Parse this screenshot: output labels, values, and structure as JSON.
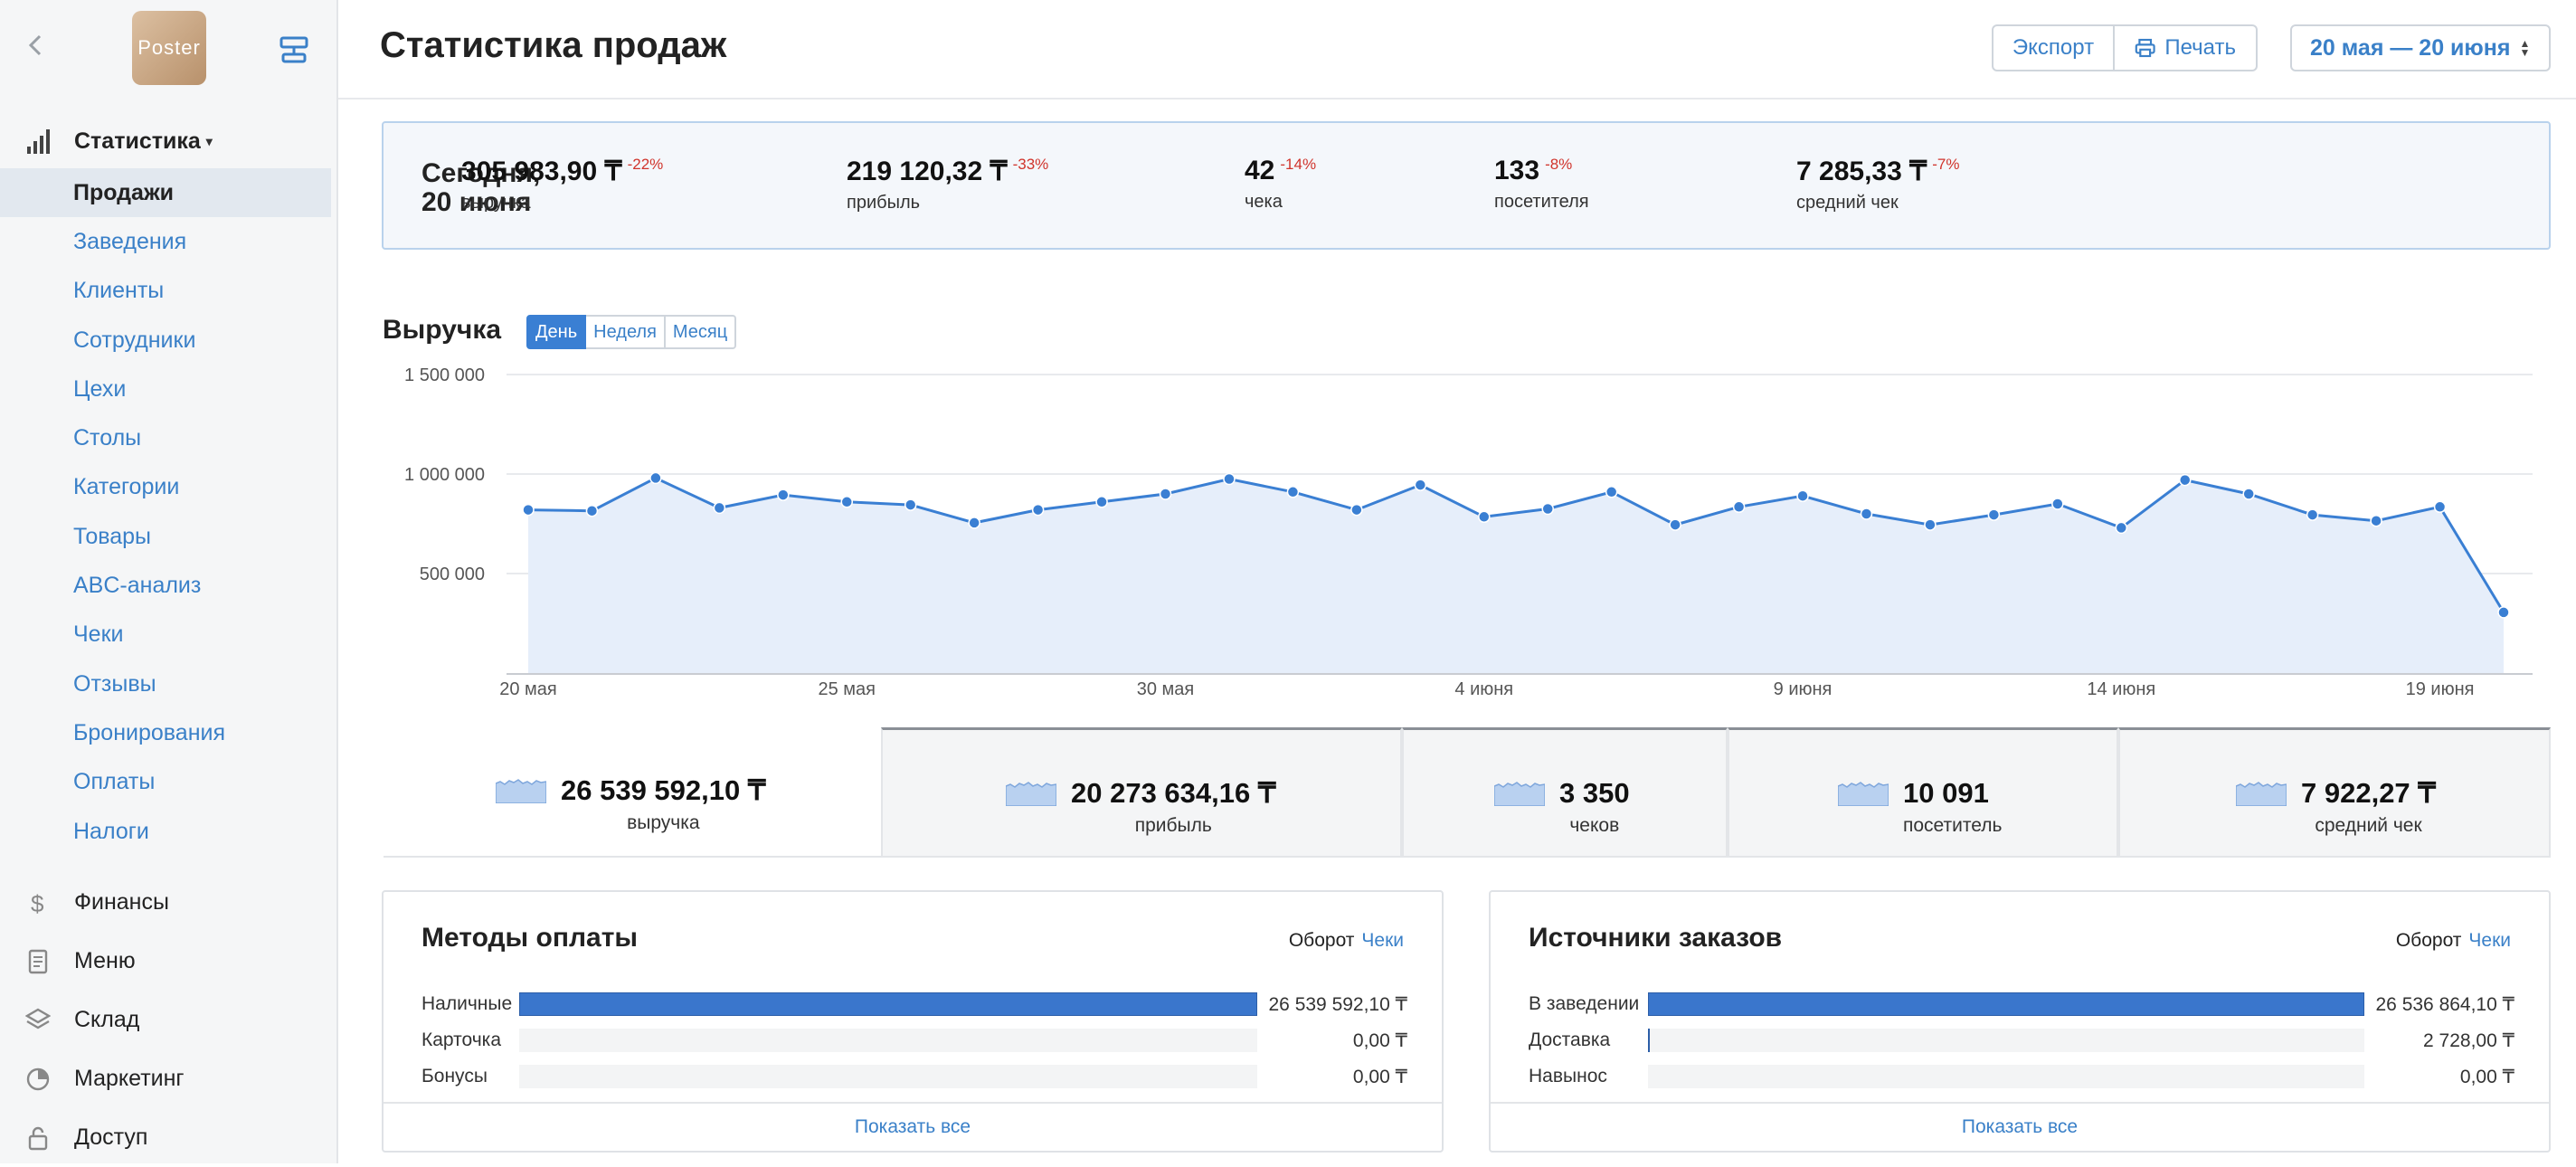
{
  "app": {
    "logo_text": "Poster"
  },
  "sidebar": {
    "section": {
      "label": "Статистика"
    },
    "items": [
      {
        "label": "Продажи",
        "active": true
      },
      {
        "label": "Заведения"
      },
      {
        "label": "Клиенты"
      },
      {
        "label": "Сотрудники"
      },
      {
        "label": "Цехи"
      },
      {
        "label": "Столы"
      },
      {
        "label": "Категории"
      },
      {
        "label": "Товары"
      },
      {
        "label": "ABC-анализ"
      },
      {
        "label": "Чеки"
      },
      {
        "label": "Отзывы"
      },
      {
        "label": "Бронирования"
      },
      {
        "label": "Оплаты"
      },
      {
        "label": "Налоги"
      }
    ],
    "main": [
      {
        "label": "Финансы",
        "icon": "dollar-icon"
      },
      {
        "label": "Меню",
        "icon": "document-icon"
      },
      {
        "label": "Склад",
        "icon": "layers-icon"
      },
      {
        "label": "Маркетинг",
        "icon": "pie-icon"
      },
      {
        "label": "Доступ",
        "icon": "lock-icon"
      }
    ]
  },
  "header": {
    "title": "Статистика продаж",
    "export_label": "Экспорт",
    "print_label": "Печать",
    "date_range": "20 мая — 20 июня"
  },
  "today": {
    "label_line1": "Сегодня,",
    "label_line2": "20 июня",
    "kpis": [
      {
        "value": "305 983,90 ₸",
        "delta": "-22%",
        "label": "выручка"
      },
      {
        "value": "219 120,32 ₸",
        "delta": "-33%",
        "label": "прибыль"
      },
      {
        "value": "42",
        "delta": "-14%",
        "label": "чека"
      },
      {
        "value": "133",
        "delta": "-8%",
        "label": "посетителя"
      },
      {
        "value": "7 285,33 ₸",
        "delta": "-7%",
        "label": "средний чек"
      }
    ]
  },
  "revenue": {
    "title": "Выручка",
    "periods": [
      "День",
      "Неделя",
      "Месяц"
    ],
    "active_period": "День"
  },
  "chart_data": {
    "type": "area",
    "y_ticks": [
      "1 500 000",
      "1 000 000",
      "500 000"
    ],
    "y_tick_values": [
      1500000,
      1000000,
      500000
    ],
    "ylim": [
      0,
      1500000
    ],
    "x_tick_labels": [
      "20 мая",
      "25 мая",
      "30 мая",
      "4 июня",
      "9 июня",
      "14 июня",
      "19 июня"
    ],
    "x_tick_index": [
      0,
      5,
      10,
      15,
      20,
      25,
      30
    ],
    "values": [
      820000,
      815000,
      980000,
      830000,
      895000,
      860000,
      845000,
      755000,
      820000,
      860000,
      900000,
      975000,
      910000,
      820000,
      945000,
      785000,
      825000,
      910000,
      745000,
      835000,
      890000,
      800000,
      745000,
      795000,
      850000,
      730000,
      970000,
      900000,
      795000,
      765000,
      835000,
      305000
    ],
    "grid": true,
    "colors": {
      "line": "#3a7fd3",
      "fill": "#e6eefa"
    }
  },
  "totals": [
    {
      "value": "26 539 592,10 ₸",
      "label": "выручка"
    },
    {
      "value": "20 273 634,16 ₸",
      "label": "прибыль"
    },
    {
      "value": "3 350",
      "label": "чеков"
    },
    {
      "value": "10 091",
      "label": "посетитель"
    },
    {
      "value": "7 922,27 ₸",
      "label": "средний чек"
    }
  ],
  "payment_methods": {
    "title": "Методы оплаты",
    "toggle_active": "Оборот",
    "toggle_link": "Чеки",
    "rows": [
      {
        "label": "Наличные",
        "value": "26 539 592,10 ₸",
        "share": 1.0
      },
      {
        "label": "Карточка",
        "value": "0,00 ₸",
        "share": 0
      },
      {
        "label": "Бонусы",
        "value": "0,00 ₸",
        "share": 0
      }
    ],
    "footer": "Показать все"
  },
  "order_sources": {
    "title": "Источники заказов",
    "toggle_active": "Оборот",
    "toggle_link": "Чеки",
    "rows": [
      {
        "label": "В заведении",
        "value": "26 536 864,10 ₸",
        "share": 1.0
      },
      {
        "label": "Доставка",
        "value": "2 728,00 ₸",
        "share": 0.0001
      },
      {
        "label": "Навынос",
        "value": "0,00 ₸",
        "share": 0
      }
    ],
    "footer": "Показать все"
  }
}
